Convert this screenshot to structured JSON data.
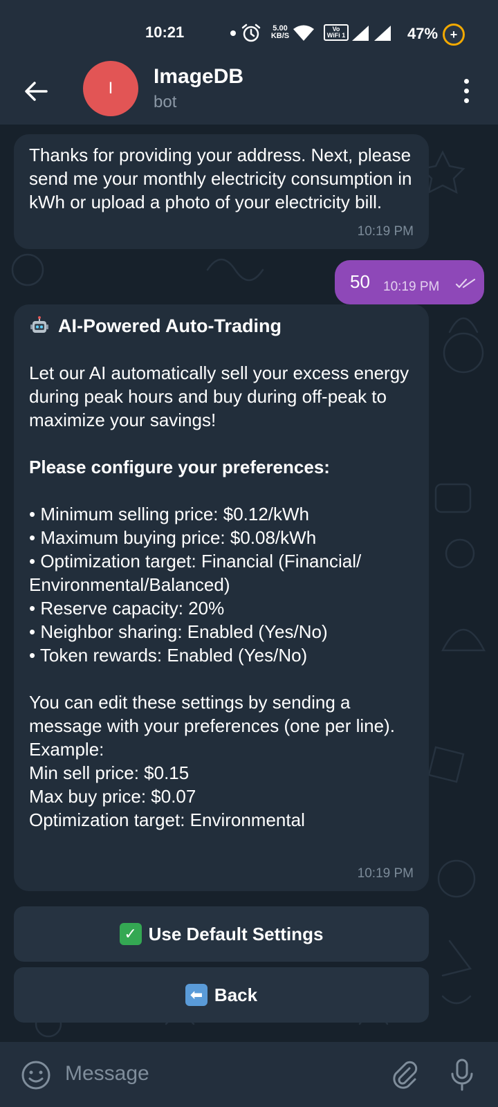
{
  "status_bar": {
    "time": "10:21",
    "net_speed_value": "5.00",
    "net_speed_unit": "KB/S",
    "vowifi_top": "Vo",
    "vowifi_bottom": "WiFi 1",
    "battery": "47%"
  },
  "header": {
    "avatar_letter": "I",
    "title": "ImageDB",
    "subtitle": "bot"
  },
  "messages": [
    {
      "text": "Thanks for providing your address. Next, please send me your monthly electricity consumption in kWh or upload a photo of your electricity bill.",
      "time": "10:19 PM"
    },
    {
      "text": "50",
      "time": "10:19 PM"
    },
    {
      "heading": "AI-Powered Auto-Trading",
      "intro": "Let our AI automatically sell your excess energy during peak hours and buy during off-peak to maximize your savings!",
      "configure": "Please configure your preferences:",
      "bullets": [
        "• Minimum selling price: $0.12/kWh",
        "• Maximum buying price: $0.08/kWh",
        "• Optimization target: Financial (Financial/ Environmental/Balanced)",
        "• Reserve capacity: 20%",
        "• Neighbor sharing: Enabled (Yes/No)",
        "• Token rewards: Enabled (Yes/No)"
      ],
      "edit_note": "You can edit these settings by sending a message with your preferences (one per line).",
      "example_lines": [
        "Example:",
        "Min sell price: $0.15",
        "Max buy price: $0.07",
        "Optimization target: Environmental"
      ],
      "time": "10:19 PM"
    }
  ],
  "inline_buttons": {
    "default_label": "Use Default Settings",
    "back_label": "Back"
  },
  "input_bar": {
    "placeholder": "Message"
  },
  "colors": {
    "header_bg": "#232f3d",
    "chat_bg": "#17212b",
    "incoming_bubble": "#222e3b",
    "outgoing_bubble": "#8e48b8",
    "avatar": "#e25555",
    "timestamp": "#7c8b99"
  },
  "icons": {
    "back": "arrow-left-icon",
    "menu": "kebab-menu-icon",
    "emoji": "smiley-icon",
    "attach": "paperclip-icon",
    "mic": "microphone-icon",
    "robot": "robot-icon",
    "check": "check-mark-icon",
    "back_emoji": "left-arrow-emoji-icon"
  }
}
